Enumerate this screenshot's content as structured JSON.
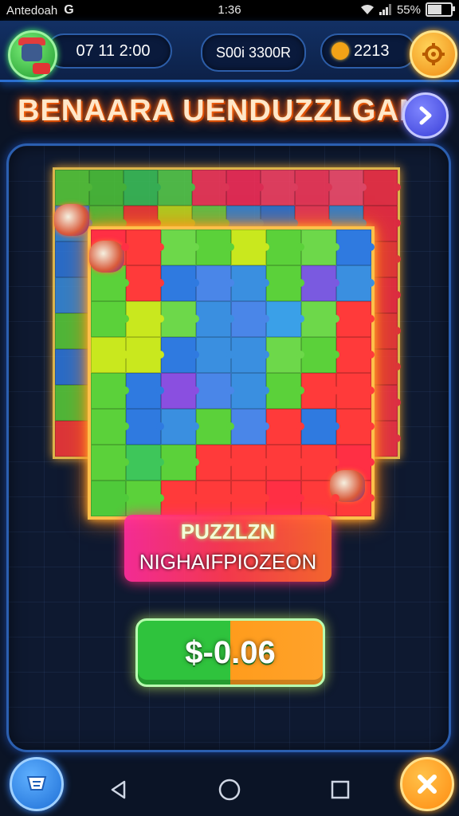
{
  "status_bar": {
    "app_label": "Antedoah",
    "g_label": "G",
    "time": "1:36",
    "battery": "55%",
    "battery_level": 0.55
  },
  "hud": {
    "timer": "07 11 2:00",
    "score": "S00i 3300R",
    "coins": "2213"
  },
  "title": "BENAARA UENDUZZLGAN",
  "puzzle": {
    "back_colors": [
      "#5bd13a",
      "#4fca3a",
      "#3ec65a",
      "#5ad24c",
      "#ff3a5c",
      "#ff2f5a",
      "#ff4466",
      "#ff3a5c",
      "#ff5070",
      "#ff3448",
      "#3a8fe0",
      "#5bd13a",
      "#ff3a3a",
      "#c9e81e",
      "#6dd84a",
      "#3a8fe0",
      "#2f7ae0",
      "#ff3a5c",
      "#3a8fe0",
      "#ff2f44",
      "#2f7ae0",
      "#6ad84a",
      "#5bd13a",
      "#4a86e8",
      "#3a8fe0",
      "#8a4fe0",
      "#2f7ae0",
      "#4fca3a",
      "#7a5ae0",
      "#ff3a3a",
      "#3a8fe0",
      "#5bd13a",
      "#c9e81e",
      "#3a8fe0",
      "#3a8fe0",
      "#3aa0e8",
      "#6dd84a",
      "#4fca3a",
      "#ff3a3a",
      "#ff2f44",
      "#5bd13a",
      "#3a8fe0",
      "#4fca3a",
      "#2f7ae0",
      "#2f7ae0",
      "#5bd13a",
      "#4fca3a",
      "#6ad84a",
      "#ff3a3a",
      "#ff3a3a",
      "#2f7ae0",
      "#5bd13a",
      "#2f7ae0",
      "#4fca3a",
      "#5bd13a",
      "#ff3a3a",
      "#2f7ae0",
      "#ff3a3a",
      "#ff2f44",
      "#ff3a3a",
      "#5bd13a",
      "#3ec65a",
      "#2f7ae0",
      "#5bd13a",
      "#ff3a3a",
      "#ff3a3a",
      "#5bd13a",
      "#ff3a3a",
      "#ff3a5c",
      "#ff3448",
      "#ff3a3a",
      "#5bd13a",
      "#2f7ae0",
      "#ff3a3a",
      "#ff3a3a",
      "#ff3a5c",
      "#ff2f44",
      "#ff3a3a",
      "#ff3a5c",
      "#ff3448"
    ],
    "front_colors": [
      "#ff2f44",
      "#ff3a3a",
      "#6dd84a",
      "#5bd13a",
      "#c9e81e",
      "#5bd13a",
      "#6dd84a",
      "#2f7ae0",
      "#5bd13a",
      "#ff3a3a",
      "#2f7ae0",
      "#4a86e8",
      "#3a8fe0",
      "#5bd13a",
      "#7a5ae0",
      "#3a8fe0",
      "#5bd13a",
      "#c9e81e",
      "#6dd84a",
      "#3a8fe0",
      "#4a86e8",
      "#3aa0e8",
      "#6dd84a",
      "#ff3a3a",
      "#c9e81e",
      "#c9e81e",
      "#2f7ae0",
      "#3a8fe0",
      "#3a8fe0",
      "#6dd84a",
      "#5bd13a",
      "#ff3a3a",
      "#5bd13a",
      "#2f7ae0",
      "#8a4fe0",
      "#4a86e8",
      "#3a8fe0",
      "#5bd13a",
      "#ff3a3a",
      "#ff3a3a",
      "#5bd13a",
      "#2f7ae0",
      "#3a8fe0",
      "#5bd13a",
      "#4a86e8",
      "#ff3a3a",
      "#2f7ae0",
      "#ff3a3a",
      "#5bd13a",
      "#3ec65a",
      "#5bd13a",
      "#ff3a3a",
      "#ff3a3a",
      "#ff3a3a",
      "#ff3a3a",
      "#ff2f44",
      "#4fca3a",
      "#5bd13a",
      "#ff3a3a",
      "#ff3a3a",
      "#ff3a3a",
      "#ff2f44",
      "#ff3a3a",
      "#ff3a3a"
    ],
    "frame_color": "#ffc04a"
  },
  "caption": {
    "line1": "PUZZLZN",
    "line2": "NIGHAIFPIOZEON"
  },
  "price_button": "$-0.06",
  "bottom": {
    "left_icon": "cart-icon",
    "right_icon": "close-x-icon"
  },
  "nav": [
    "back-triangle-icon",
    "home-circle-icon",
    "recents-square-icon"
  ]
}
